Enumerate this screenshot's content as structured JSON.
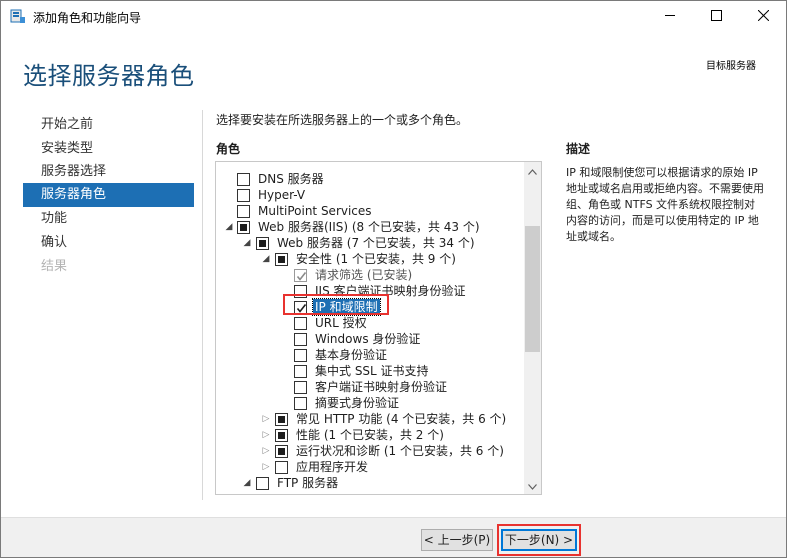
{
  "window": {
    "title": "添加角色和功能向导",
    "accent_color": "#1d6fb4",
    "highlight_color": "#e8322f"
  },
  "header": {
    "page_title": "选择服务器角色",
    "target_server": "目标服务器"
  },
  "nav": {
    "items": [
      {
        "label": "开始之前",
        "state": "normal"
      },
      {
        "label": "安装类型",
        "state": "normal"
      },
      {
        "label": "服务器选择",
        "state": "normal"
      },
      {
        "label": "服务器角色",
        "state": "active"
      },
      {
        "label": "功能",
        "state": "normal"
      },
      {
        "label": "确认",
        "state": "normal"
      },
      {
        "label": "结果",
        "state": "disabled"
      }
    ]
  },
  "main": {
    "instruction": "选择要安装在所选服务器上的一个或多个角色。",
    "roles_label": "角色",
    "description_label": "描述",
    "description_text": "IP 和域限制使您可以根据请求的原始 IP 地址或域名启用或拒绝内容。不需要使用组、角色或 NTFS 文件系统权限控制对内容的访问，而是可以使用特定的 IP 地址或域名。"
  },
  "roles_tree": [
    {
      "label": "DNS 服务器",
      "level": 0,
      "expander": "none",
      "checkbox": "unchecked"
    },
    {
      "label": "Hyper-V",
      "level": 0,
      "expander": "none",
      "checkbox": "unchecked"
    },
    {
      "label": "MultiPoint Services",
      "level": 0,
      "expander": "none",
      "checkbox": "unchecked"
    },
    {
      "label": "Web 服务器(IIS) (8 个已安装，共 43 个)",
      "level": 0,
      "expander": "expanded",
      "checkbox": "partial"
    },
    {
      "label": "Web 服务器 (7 个已安装，共 34 个)",
      "level": 1,
      "expander": "expanded",
      "checkbox": "partial"
    },
    {
      "label": "安全性 (1 个已安装，共 9 个)",
      "level": 2,
      "expander": "expanded",
      "checkbox": "partial"
    },
    {
      "label": "请求筛选 (已安装)",
      "level": 3,
      "expander": "none",
      "checkbox": "checked-gray"
    },
    {
      "label": "IIS 客户端证书映射身份验证",
      "level": 3,
      "expander": "none",
      "checkbox": "unchecked"
    },
    {
      "label": "IP 和域限制",
      "level": 3,
      "expander": "none",
      "checkbox": "checked",
      "selected": true
    },
    {
      "label": "URL 授权",
      "level": 3,
      "expander": "none",
      "checkbox": "unchecked"
    },
    {
      "label": "Windows 身份验证",
      "level": 3,
      "expander": "none",
      "checkbox": "unchecked"
    },
    {
      "label": "基本身份验证",
      "level": 3,
      "expander": "none",
      "checkbox": "unchecked"
    },
    {
      "label": "集中式 SSL 证书支持",
      "level": 3,
      "expander": "none",
      "checkbox": "unchecked"
    },
    {
      "label": "客户端证书映射身份验证",
      "level": 3,
      "expander": "none",
      "checkbox": "unchecked"
    },
    {
      "label": "摘要式身份验证",
      "level": 3,
      "expander": "none",
      "checkbox": "unchecked"
    },
    {
      "label": "常见 HTTP 功能 (4 个已安装，共 6 个)",
      "level": 2,
      "expander": "collapsed",
      "checkbox": "partial"
    },
    {
      "label": "性能 (1 个已安装，共 2 个)",
      "level": 2,
      "expander": "collapsed",
      "checkbox": "partial"
    },
    {
      "label": "运行状况和诊断 (1 个已安装，共 6 个)",
      "level": 2,
      "expander": "collapsed",
      "checkbox": "partial"
    },
    {
      "label": "应用程序开发",
      "level": 2,
      "expander": "collapsed",
      "checkbox": "unchecked"
    },
    {
      "label": "FTP 服务器",
      "level": 1,
      "expander": "expanded",
      "checkbox": "unchecked"
    }
  ],
  "footer": {
    "prev_label": "< 上一步(P)",
    "next_label": "下一步(N) >"
  }
}
